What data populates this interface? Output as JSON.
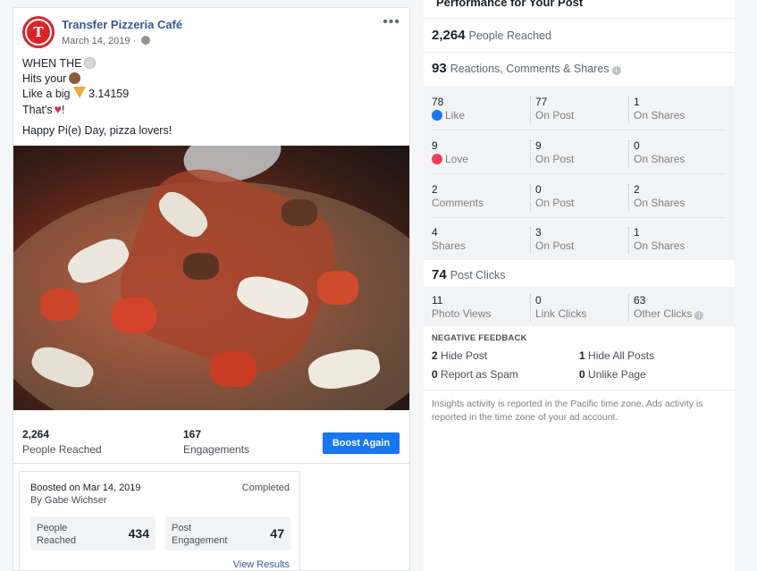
{
  "post": {
    "page_name": "Transfer Pizzeria Café",
    "date": "March 14, 2019 ·",
    "logo_letter": "T",
    "text_lines": [
      "WHEN THE",
      "Hits your",
      "Like a big",
      "3.14159",
      "That's",
      "!"
    ],
    "closing_line": "Happy Pi(e) Day, pizza lovers!",
    "more_label": "•••"
  },
  "post_stats": {
    "reached_value": "2,264",
    "reached_label": "People Reached",
    "engagements_value": "167",
    "engagements_label": "Engagements",
    "boost_again_label": "Boost Again"
  },
  "boost": {
    "title": "Boosted on Mar 14, 2019",
    "by": "By Gabe Wichser",
    "status": "Completed",
    "reached_label_1": "People",
    "reached_label_2": "Reached",
    "reached_value": "434",
    "engagement_label_1": "Post",
    "engagement_label_2": "Engagement",
    "engagement_value": "47",
    "view_results": "View Results"
  },
  "performance": {
    "title": "Performance for Your Post",
    "people_reached_value": "2,264",
    "people_reached_label": "People Reached",
    "rcs_value": "93",
    "rcs_label": "Reactions, Comments & Shares",
    "reactions": [
      {
        "value": "78",
        "label": "Like",
        "post_value": "77",
        "post_label": "On Post",
        "share_value": "1",
        "share_label": "On Shares"
      },
      {
        "value": "9",
        "label": "Love",
        "post_value": "9",
        "post_label": "On Post",
        "share_value": "0",
        "share_label": "On Shares"
      },
      {
        "value": "2",
        "label": "Comments",
        "post_value": "0",
        "post_label": "On Post",
        "share_value": "2",
        "share_label": "On Shares"
      },
      {
        "value": "4",
        "label": "Shares",
        "post_value": "3",
        "post_label": "On Post",
        "share_value": "1",
        "share_label": "On Shares"
      }
    ],
    "post_clicks_value": "74",
    "post_clicks_label": "Post Clicks",
    "clicks": [
      {
        "value": "11",
        "label": "Photo Views"
      },
      {
        "value": "0",
        "label": "Link Clicks"
      },
      {
        "value": "63",
        "label": "Other Clicks"
      }
    ],
    "negative_title": "NEGATIVE FEEDBACK",
    "negative": [
      {
        "value": "2",
        "label": "Hide Post"
      },
      {
        "value": "1",
        "label": "Hide All Posts"
      },
      {
        "value": "0",
        "label": "Report as Spam"
      },
      {
        "value": "0",
        "label": "Unlike Page"
      }
    ],
    "footnote": "Insights activity is reported in the Pacific time zone. Ads activity is reported in the time zone of your ad account."
  },
  "colors": {
    "accent": "#1877f2",
    "link": "#365899",
    "brand_red": "#d9252a"
  }
}
